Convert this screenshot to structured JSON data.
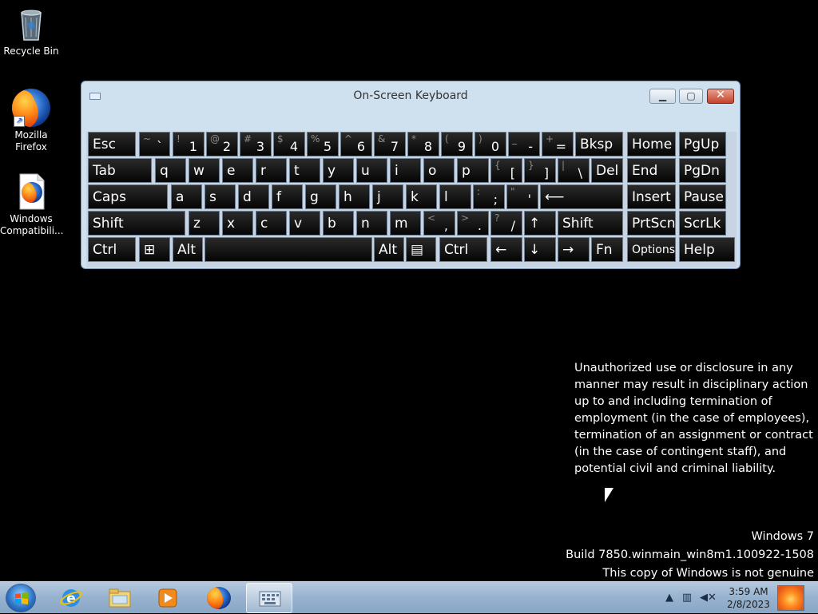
{
  "desktop": {
    "icons": [
      {
        "label": "Recycle Bin",
        "icon": "recycle-bin-icon"
      },
      {
        "label": "Mozilla Firefox",
        "icon": "firefox-icon"
      },
      {
        "label": "Windows Compatibili...",
        "icon": "firefox-document-icon"
      }
    ]
  },
  "osk": {
    "title": "On-Screen Keyboard",
    "rows": [
      [
        {
          "label": "Esc"
        },
        {
          "top": "~",
          "main": "`"
        },
        {
          "top": "!",
          "main": "1"
        },
        {
          "top": "@",
          "main": "2"
        },
        {
          "top": "#",
          "main": "3"
        },
        {
          "top": "$",
          "main": "4"
        },
        {
          "top": "%",
          "main": "5"
        },
        {
          "top": "^",
          "main": "6"
        },
        {
          "top": "&",
          "main": "7"
        },
        {
          "top": "*",
          "main": "8"
        },
        {
          "top": "(",
          "main": "9"
        },
        {
          "top": ")",
          "main": "0"
        },
        {
          "top": "_",
          "main": "-"
        },
        {
          "top": "+",
          "main": "="
        },
        {
          "label": "Bksp"
        },
        {
          "label": "Home"
        },
        {
          "label": "PgUp"
        }
      ],
      [
        {
          "label": "Tab"
        },
        {
          "label": "q"
        },
        {
          "label": "w"
        },
        {
          "label": "e"
        },
        {
          "label": "r"
        },
        {
          "label": "t"
        },
        {
          "label": "y"
        },
        {
          "label": "u"
        },
        {
          "label": "i"
        },
        {
          "label": "o"
        },
        {
          "label": "p"
        },
        {
          "top": "{",
          "main": "["
        },
        {
          "top": "}",
          "main": "]"
        },
        {
          "top": "|",
          "main": "\\"
        },
        {
          "label": "Del"
        },
        {
          "label": "End"
        },
        {
          "label": "PgDn"
        }
      ],
      [
        {
          "label": "Caps"
        },
        {
          "label": "a"
        },
        {
          "label": "s"
        },
        {
          "label": "d"
        },
        {
          "label": "f"
        },
        {
          "label": "g"
        },
        {
          "label": "h"
        },
        {
          "label": "j"
        },
        {
          "label": "k"
        },
        {
          "label": "l"
        },
        {
          "top": ":",
          "main": ";"
        },
        {
          "top": "\"",
          "main": "'"
        },
        {
          "label": "⟵"
        },
        {
          "label": "Insert"
        },
        {
          "label": "Pause"
        }
      ],
      [
        {
          "label": "Shift"
        },
        {
          "label": "z"
        },
        {
          "label": "x"
        },
        {
          "label": "c"
        },
        {
          "label": "v"
        },
        {
          "label": "b"
        },
        {
          "label": "n"
        },
        {
          "label": "m"
        },
        {
          "top": "<",
          "main": ","
        },
        {
          "top": ">",
          "main": "."
        },
        {
          "top": "?",
          "main": "/"
        },
        {
          "label": "↑"
        },
        {
          "label": "Shift"
        },
        {
          "label": "PrtScn"
        },
        {
          "label": "ScrLk"
        }
      ],
      [
        {
          "label": "Ctrl"
        },
        {
          "label": "⊞"
        },
        {
          "label": "Alt"
        },
        {
          "label": ""
        },
        {
          "label": "Alt"
        },
        {
          "label": "▤"
        },
        {
          "label": "Ctrl"
        },
        {
          "label": "←"
        },
        {
          "label": "↓"
        },
        {
          "label": "→"
        },
        {
          "label": "Fn"
        },
        {
          "label": "Options"
        },
        {
          "label": "Help"
        }
      ]
    ]
  },
  "notice": {
    "text": "Unauthorized use or disclosure in any manner may result in disciplinary action up to and including termination of employment (in the case of employees), termination of an assignment or contract (in the case of contingent staff), and potential civil and criminal liability."
  },
  "watermark": {
    "line1": "Windows 7",
    "line2": "Build 7850.winmain_win8m1.100922-1508",
    "line3": "This copy of Windows is not genuine"
  },
  "taskbar": {
    "items": [
      {
        "icon": "internet-explorer-icon"
      },
      {
        "icon": "windows-explorer-icon"
      },
      {
        "icon": "media-player-icon"
      },
      {
        "icon": "firefox-icon"
      },
      {
        "icon": "on-screen-keyboard-icon",
        "active": true
      }
    ],
    "clock_time": "3:59 AM",
    "clock_date": "2/8/2023"
  }
}
